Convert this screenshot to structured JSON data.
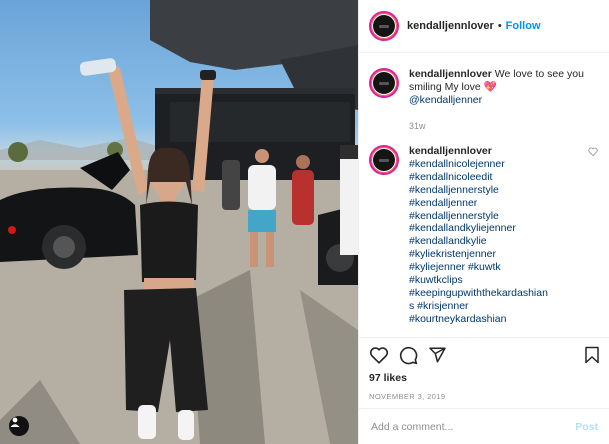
{
  "post": {
    "username": "kendalljennlover",
    "separator": "•",
    "follow_label": "Follow"
  },
  "caption": {
    "username": "kendalljennlover",
    "text": "We love to see you smiling My love",
    "emoji": "💖",
    "mention": "@kendalljenner",
    "age": "31w"
  },
  "comment": {
    "username": "kendalljennlover",
    "hashtags": [
      "#kendallnicolejenner",
      "#kendallnicoleedit",
      "#kendalljennerstyle",
      "#kendalljenner",
      "#kendalljennerstyle",
      "#kendallandkyliejenner",
      "#kendallandkylie",
      "#kyliekristenjenner",
      "#kyliejenner #kuwtk",
      "#kuwtkclips",
      "#keepingupwiththekardashian",
      "s #krisjenner",
      "#kourtneykardashian"
    ]
  },
  "actions": {
    "likes": "97 likes",
    "date": "NOVEMBER 3, 2019"
  },
  "add_comment": {
    "placeholder": "Add a comment...",
    "post_label": "Post"
  },
  "icons": {
    "like": "heart-icon",
    "comment": "comment-icon",
    "share": "share-icon",
    "save": "bookmark-icon",
    "user_tag": "user-tag-icon",
    "comment_like": "heart-outline-icon"
  },
  "colors": {
    "link": "#0095f6",
    "hashtag": "#00376b",
    "muted": "#8e8e8e"
  }
}
